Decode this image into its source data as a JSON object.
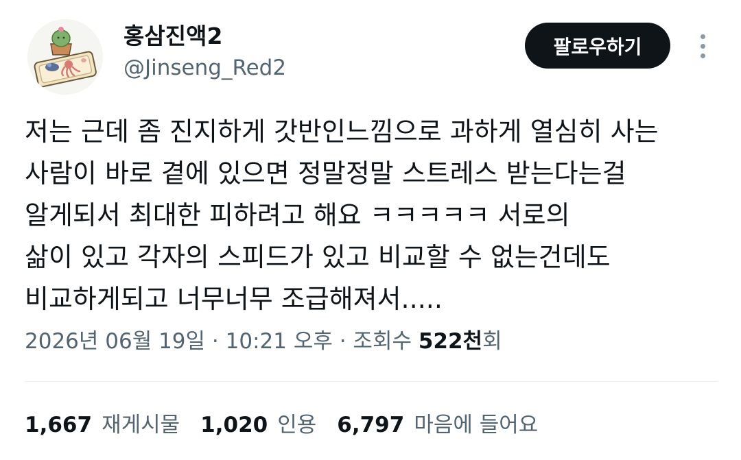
{
  "author": {
    "display_name": "홍삼진액2",
    "handle": "@Jinseng_Red2",
    "avatar_icon": "cactus-and-tray-illustration-avatar"
  },
  "actions": {
    "follow_label": "팔로우하기",
    "more_icon": "more-vertical-icon"
  },
  "tweet": {
    "lines": [
      "저는 근데 좀 진지하게 갓반인느낌으로 과하게 열심히 사는",
      "사람이 바로 곁에 있으면 정말정말 스트레스 받는다는걸",
      "알게되서 최대한 피하려고 해요 ㅋㅋㅋㅋㅋ 서로의",
      "삶이 있고 각자의 스피드가 있고 비교할 수 없는건데도",
      "비교하게되고 너무너무 조급해져서....."
    ]
  },
  "meta": {
    "date": "2026년 06월 19일",
    "sep1": " · ",
    "time": "10:21 오후",
    "sep2": " · ",
    "views_label": "조회수 ",
    "views_number": "522천",
    "views_suffix": "회"
  },
  "stats": {
    "retweets": {
      "count": "1,667",
      "label": "재게시물"
    },
    "quotes": {
      "count": "1,020",
      "label": "인용"
    },
    "likes": {
      "count": "6,797",
      "label": "마음에 들어요"
    }
  },
  "colors": {
    "text_primary": "#0f1419",
    "text_secondary": "#536471",
    "button_bg": "#0f1419",
    "button_text": "#ffffff",
    "divider": "#eff3f4"
  }
}
